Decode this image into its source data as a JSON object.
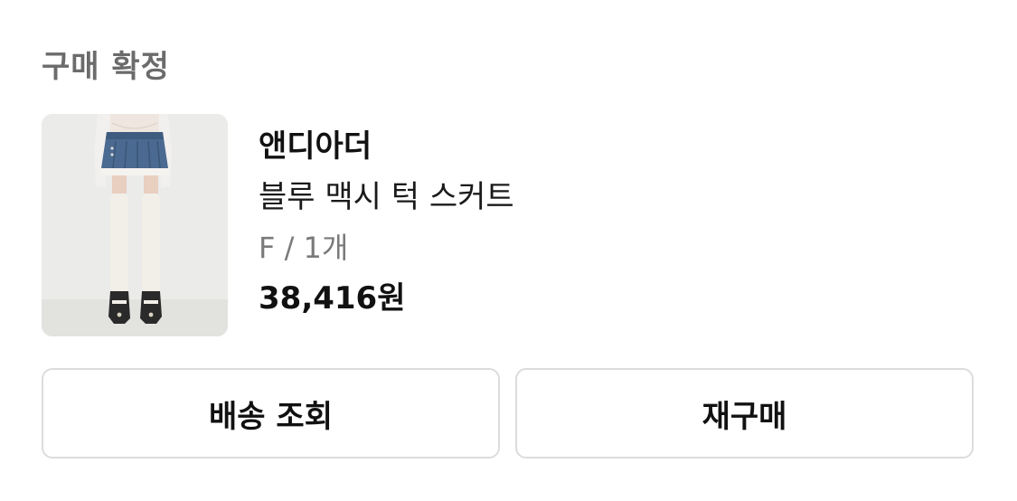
{
  "order": {
    "status": "구매 확정"
  },
  "product": {
    "brand": "앤디아더",
    "name": "블루 맥시 턱 스커트",
    "option": "F / 1개",
    "price": "38,416원",
    "image_alt": "블루 맥시 턱 스커트"
  },
  "actions": {
    "track_delivery": "배송 조회",
    "repurchase": "재구매"
  },
  "colors": {
    "status_text": "#6b6b6b",
    "primary_text": "#111111",
    "secondary_text": "#7a7a7a",
    "button_border": "#dcdcdc",
    "denim": "#4a6a91"
  }
}
